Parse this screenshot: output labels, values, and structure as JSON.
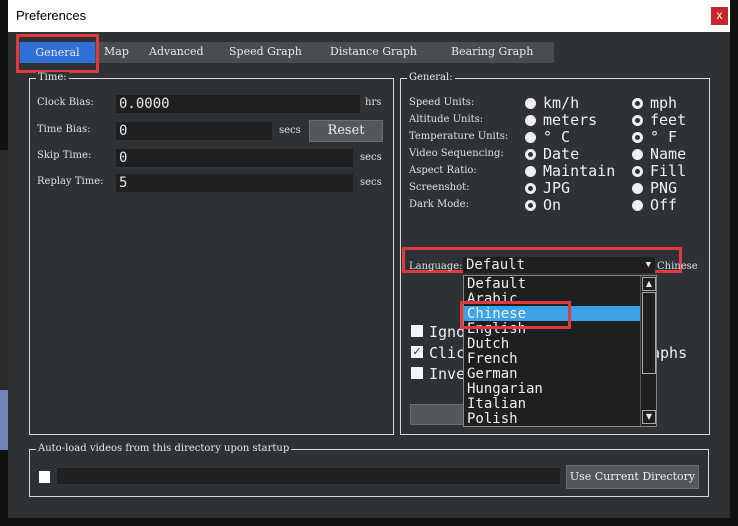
{
  "window": {
    "title": "Preferences",
    "close": "x"
  },
  "tabs": [
    {
      "label": "General",
      "active": true
    },
    {
      "label": "Map"
    },
    {
      "label": "Advanced"
    },
    {
      "label": "Speed Graph"
    },
    {
      "label": "Distance Graph"
    },
    {
      "label": "Bearing Graph"
    }
  ],
  "time": {
    "legend": "Time:",
    "clock_bias": {
      "label": "Clock Bias:",
      "value": "0.0000",
      "unit": "hrs"
    },
    "time_bias": {
      "label": "Time Bias:",
      "value": "0",
      "unit": "secs",
      "reset": "Reset"
    },
    "skip_time": {
      "label": "Skip Time:",
      "value": "0",
      "unit": "secs"
    },
    "replay_time": {
      "label": "Replay Time:",
      "value": "5",
      "unit": "secs"
    }
  },
  "general": {
    "legend": "General:",
    "rows": [
      {
        "label": "Speed Units:",
        "a": "km/h",
        "b": "mph",
        "selected": "a"
      },
      {
        "label": "Altitude Units:",
        "a": "meters",
        "b": "feet",
        "selected": "a"
      },
      {
        "label": "Temperature Units:",
        "a": "° C",
        "b": "° F",
        "selected": "a"
      },
      {
        "label": "Video Sequencing:",
        "a": "Date",
        "b": "Name",
        "selected": "b"
      },
      {
        "label": "Aspect Ratio:",
        "a": "Maintain",
        "b": "Fill",
        "selected": "a"
      },
      {
        "label": "Screenshot:",
        "a": "JPG",
        "b": "PNG",
        "selected": "b"
      },
      {
        "label": "Dark Mode:",
        "a": "On",
        "b": "Off",
        "selected": "b"
      }
    ],
    "language": {
      "label": "Language:",
      "value": "Default",
      "hint": "Chinese",
      "options": [
        "Default",
        "Arabic",
        "Chinese",
        "English",
        "Dutch",
        "French",
        "German",
        "Hungarian",
        "Italian",
        "Polish"
      ],
      "highlighted": "Chinese"
    },
    "checkboxes": [
      {
        "label": "Igno",
        "checked": false
      },
      {
        "label": "Clic",
        "checked": true,
        "tail": "aphs"
      },
      {
        "label": "Inve",
        "checked": false
      }
    ]
  },
  "autoload": {
    "legend": "Auto-load videos from this directory upon startup",
    "path": "",
    "button": "Use Current Directory"
  },
  "colors": {
    "accent": "#2f6fd6",
    "highlight": "#3ba4e8",
    "annotation": "#e03a3f"
  }
}
